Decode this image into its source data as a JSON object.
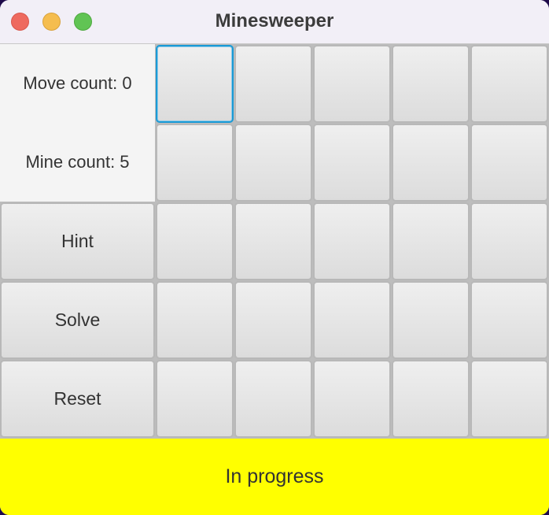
{
  "window": {
    "title": "Minesweeper"
  },
  "info": {
    "move_count": "Move count: 0",
    "mine_count": "Mine count: 5"
  },
  "buttons": {
    "hint": "Hint",
    "solve": "Solve",
    "reset": "Reset"
  },
  "board": {
    "rows": 5,
    "cols": 5,
    "focused_cell": [
      0,
      0
    ]
  },
  "status": {
    "text": "In progress",
    "color": "#ffff00"
  },
  "colors": {
    "close": "#ee6a5f",
    "minimize": "#f5bd4f",
    "zoom": "#61c454",
    "focus": "#1a9ad6"
  }
}
